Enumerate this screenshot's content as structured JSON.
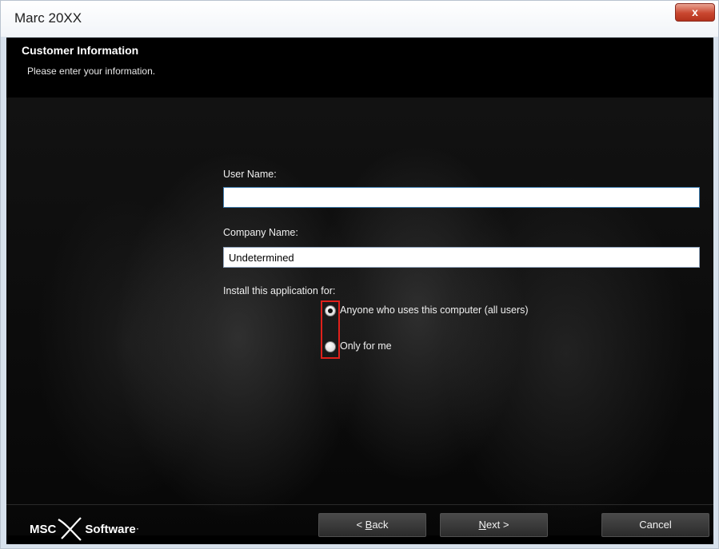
{
  "window": {
    "title": "Marc 20XX",
    "close_glyph": "x"
  },
  "header": {
    "title": "Customer Information",
    "subtitle": "Please enter your information."
  },
  "form": {
    "user_name_label": "User Name:",
    "user_name_value": "",
    "company_name_label": "Company Name:",
    "company_name_value": "Undetermined",
    "install_for_label": "Install this application for:",
    "options": [
      {
        "label": "Anyone who uses this computer (all users)",
        "selected": true
      },
      {
        "label": "Only for me",
        "selected": false
      }
    ]
  },
  "footer": {
    "logo_left": "MSC",
    "logo_right": "Software",
    "logo_tm": "·",
    "back": {
      "prefix": "< ",
      "mnemonic": "B",
      "rest": "ack"
    },
    "next": {
      "mnemonic": "N",
      "rest": "ext >"
    },
    "cancel_label": "Cancel"
  },
  "colors": {
    "highlight": "#e0201b",
    "background": "#000000"
  }
}
